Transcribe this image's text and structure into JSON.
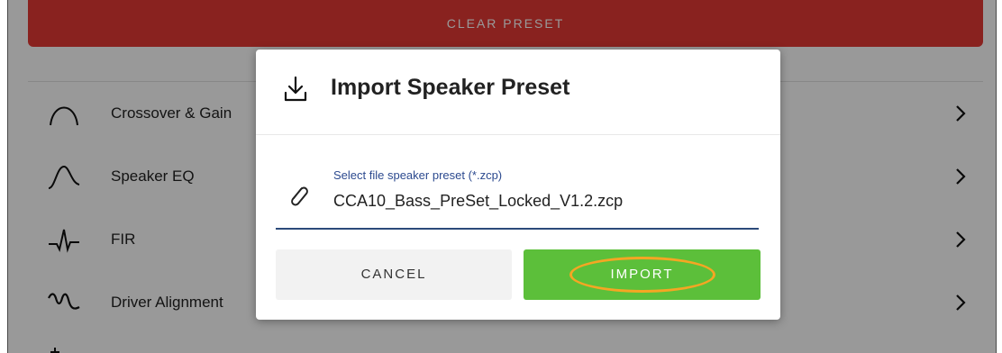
{
  "header": {
    "clear_label": "CLEAR PRESET"
  },
  "menu": {
    "items": [
      {
        "label": "Crossover & Gain",
        "icon": "crossover-curve-icon"
      },
      {
        "label": "Speaker EQ",
        "icon": "eq-curve-icon"
      },
      {
        "label": "FIR",
        "icon": "fir-waveform-icon"
      },
      {
        "label": "Driver Alignment",
        "icon": "driver-alignment-icon"
      }
    ]
  },
  "dialog": {
    "title": "Import Speaker Preset",
    "title_icon": "download-icon",
    "file_field": {
      "label": "Select file speaker preset (*.zcp)",
      "value": "CCA10_Bass_PreSet_Locked_V1.2.zcp",
      "icon": "paperclip-icon"
    },
    "cancel_label": "CANCEL",
    "import_label": "IMPORT"
  },
  "colors": {
    "clear_red": "#e53935",
    "import_green": "#5cbf3a",
    "field_accent": "#2c4a7a",
    "highlight_orange": "#f5a623"
  }
}
